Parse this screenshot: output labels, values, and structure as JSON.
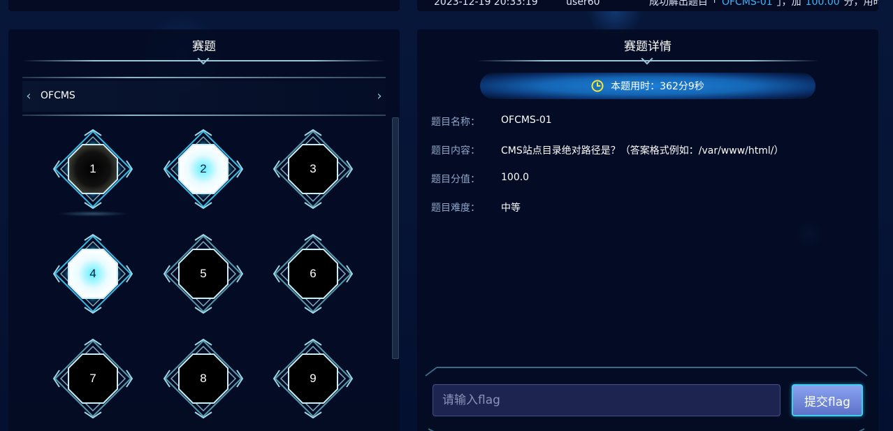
{
  "ticker": {
    "time": "2023-12-19 20:33:19",
    "user": "user60",
    "msg_prefix": "成功解出题目「",
    "msg_challenge": "OFCMS-01",
    "msg_middle": "」，加",
    "msg_score": "100.00",
    "msg_suffix": "分，用时："
  },
  "left_panel": {
    "title": "赛题",
    "category": "OFCMS",
    "tiles": [
      {
        "num": "1",
        "state": "dark",
        "selected": true
      },
      {
        "num": "2",
        "state": "solved",
        "selected": false
      },
      {
        "num": "3",
        "state": "dark",
        "selected": false
      },
      {
        "num": "4",
        "state": "solved",
        "selected": false
      },
      {
        "num": "5",
        "state": "dark",
        "selected": false
      },
      {
        "num": "6",
        "state": "dark",
        "selected": false
      },
      {
        "num": "7",
        "state": "dark",
        "selected": false
      },
      {
        "num": "8",
        "state": "dark",
        "selected": false
      },
      {
        "num": "9",
        "state": "dark",
        "selected": false
      }
    ]
  },
  "right_panel": {
    "title": "赛题详情",
    "timer_text": "本题用时：362分9秒",
    "fields": [
      {
        "label": "题目名称：",
        "value": "OFCMS-01"
      },
      {
        "label": "题目内容：",
        "value": "CMS站点目录绝对路径是？（答案格式例如：/var/www/html/）"
      },
      {
        "label": "题目分值：",
        "value": "100.0"
      },
      {
        "label": "题目难度：",
        "value": "中等"
      }
    ],
    "flag_placeholder": "请输入flag",
    "submit_label": "提交flag"
  },
  "colors": {
    "accent": "#3ed0f2",
    "highlight": "#37b7ff",
    "label": "#8fa6c8",
    "timer_icon": "#f5e830"
  },
  "icons": [
    "chevron-left-icon",
    "chevron-right-icon",
    "clock-icon"
  ]
}
